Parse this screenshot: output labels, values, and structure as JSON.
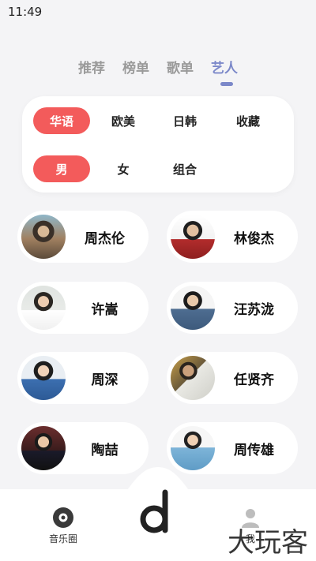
{
  "status": {
    "time": "11:49"
  },
  "tabs": [
    {
      "label": "推荐",
      "active": false
    },
    {
      "label": "榜单",
      "active": false
    },
    {
      "label": "歌单",
      "active": false
    },
    {
      "label": "艺人",
      "active": true
    }
  ],
  "filters": {
    "region": [
      {
        "label": "华语",
        "selected": true
      },
      {
        "label": "欧美",
        "selected": false
      },
      {
        "label": "日韩",
        "selected": false
      },
      {
        "label": "收藏",
        "selected": false
      }
    ],
    "gender": [
      {
        "label": "男",
        "selected": true
      },
      {
        "label": "女",
        "selected": false
      },
      {
        "label": "组合",
        "selected": false
      }
    ]
  },
  "artists": [
    {
      "name": "周杰伦"
    },
    {
      "name": "林俊杰"
    },
    {
      "name": "许嵩"
    },
    {
      "name": "汪苏泷"
    },
    {
      "name": "周深"
    },
    {
      "name": "任贤齐"
    },
    {
      "name": "陶喆"
    },
    {
      "name": "周传雄"
    }
  ],
  "bottom_nav": {
    "left_label": "音乐圈",
    "right_label": "我"
  },
  "watermark": "大玩客",
  "colors": {
    "accent": "#7b88c9",
    "chip_selected": "#f35b5b"
  }
}
